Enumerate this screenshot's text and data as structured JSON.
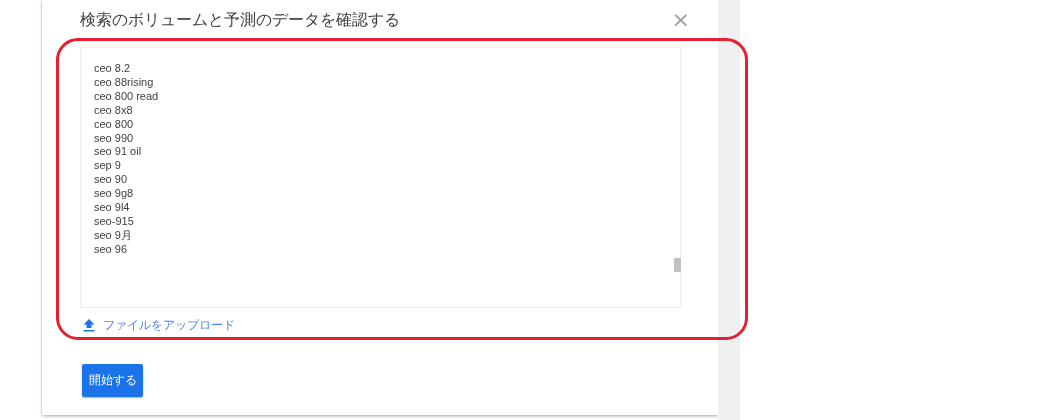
{
  "dialog": {
    "title": "検索のボリュームと予測のデータを確認する",
    "close": "×"
  },
  "keywords": [
    "ceo 8.2",
    "ceo 88rising",
    "ceo 800 read",
    "ceo 8x8",
    "ceo 800",
    "seo 990",
    "seo 91 oil",
    "sep 9",
    "seo 90",
    "seo 9g8",
    "seo 9l4",
    "seo-915",
    "seo 9月",
    "seo 96"
  ],
  "upload_link": "ファイルをアップロード",
  "start_button": "開始する"
}
